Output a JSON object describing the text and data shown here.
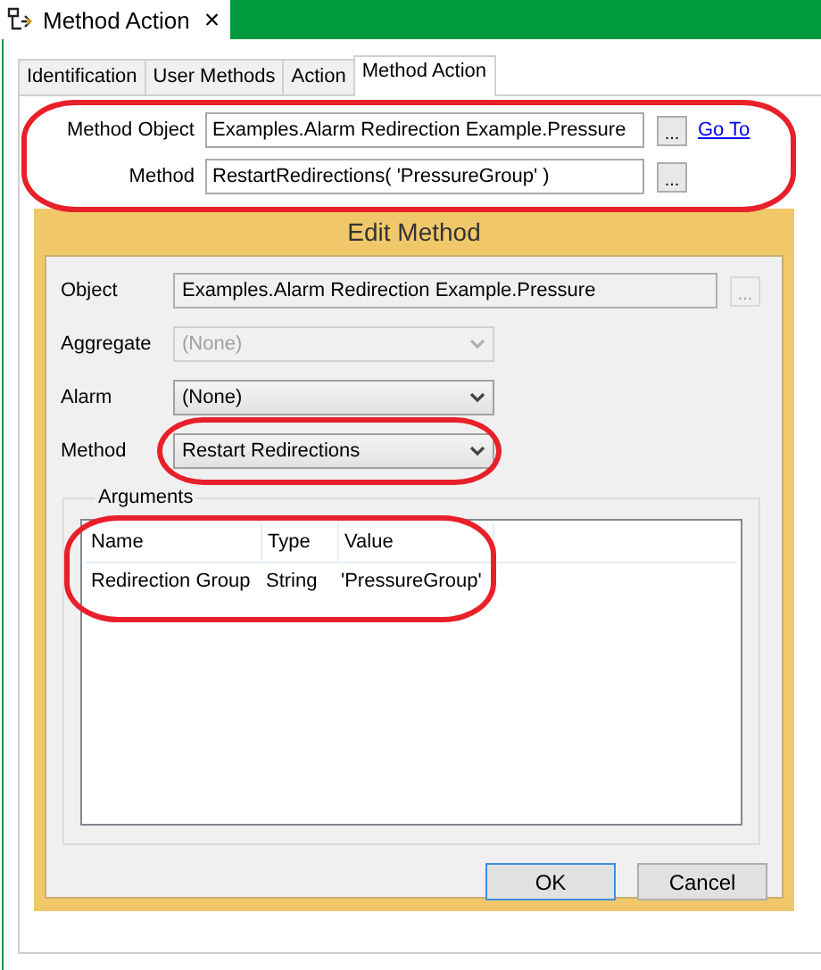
{
  "document_tab": {
    "title": "Method Action",
    "close": "×"
  },
  "tabs": [
    {
      "label": "Identification",
      "selected": false
    },
    {
      "label": "User Methods",
      "selected": false
    },
    {
      "label": "Action",
      "selected": false
    },
    {
      "label": "Method Action",
      "selected": true
    }
  ],
  "method_section": {
    "highlighted": true,
    "method_object": {
      "label": "Method Object",
      "value": "Examples.Alarm Redirection Example.Pressure",
      "browse": "...",
      "link": "Go To"
    },
    "method": {
      "label": "Method",
      "value": "RestartRedirections( 'PressureGroup' )",
      "browse": "..."
    }
  },
  "dialog": {
    "title": "Edit Method",
    "object": {
      "label": "Object",
      "value": "Examples.Alarm Redirection Example.Pressure",
      "browse": "...",
      "disabled": true
    },
    "fields": [
      {
        "label": "Aggregate",
        "value": "(None)",
        "disabled": true,
        "highlighted": false
      },
      {
        "label": "Alarm",
        "value": "(None)",
        "disabled": false,
        "highlighted": false
      },
      {
        "label": "Method",
        "value": "Restart Redirections",
        "disabled": false,
        "highlighted": true
      }
    ],
    "arguments": {
      "title": "Arguments",
      "highlighted": true,
      "columns": [
        "Name",
        "Type",
        "Value"
      ],
      "rows": [
        [
          "Redirection Group",
          "String",
          "'PressureGroup'"
        ]
      ]
    },
    "buttons": [
      {
        "label": "OK",
        "default": true
      },
      {
        "label": "Cancel",
        "default": false
      }
    ]
  }
}
